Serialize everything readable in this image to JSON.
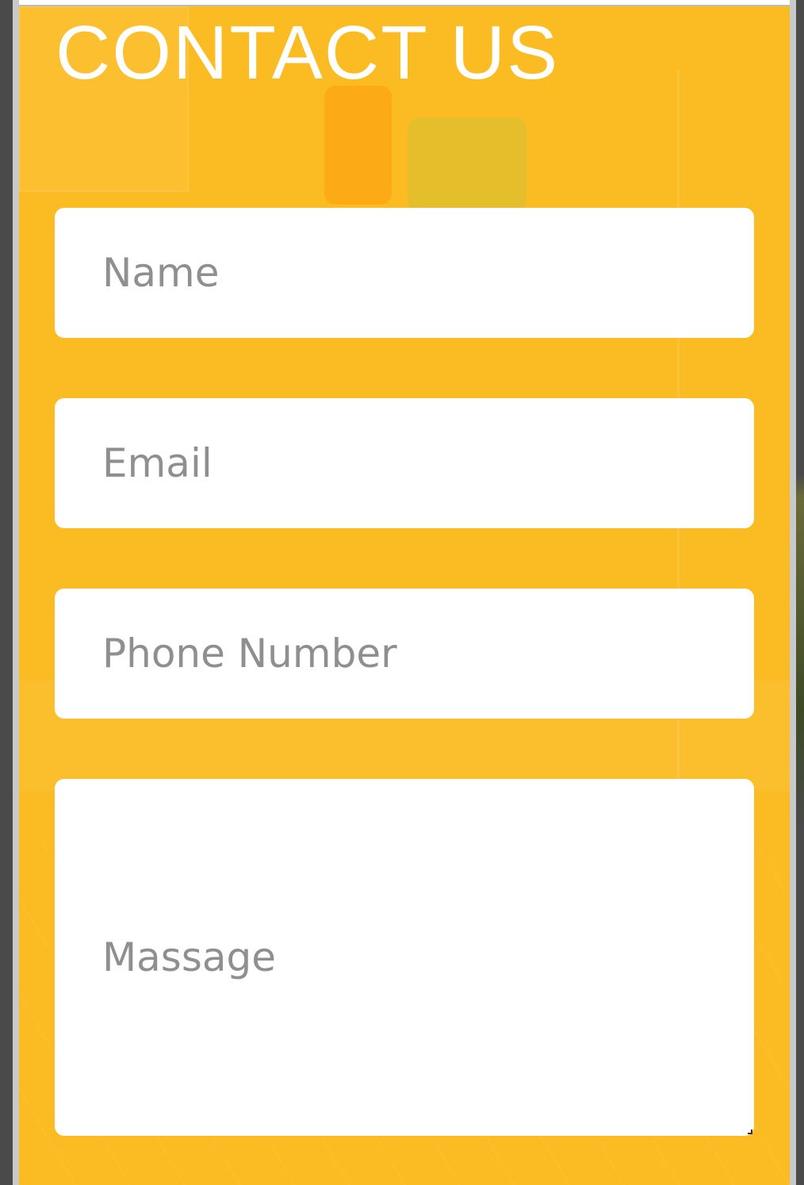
{
  "section": {
    "title": "CONTACT US"
  },
  "form": {
    "name_placeholder": "Name",
    "email_placeholder": "Email",
    "phone_placeholder": "Phone Number",
    "message_placeholder": "Massage"
  },
  "colors": {
    "panel_background": "#fbbb22",
    "title_text": "#ffffff",
    "field_background": "#ffffff",
    "placeholder_text": "#8f8f8f",
    "outer_background": "#4a4a4a"
  }
}
